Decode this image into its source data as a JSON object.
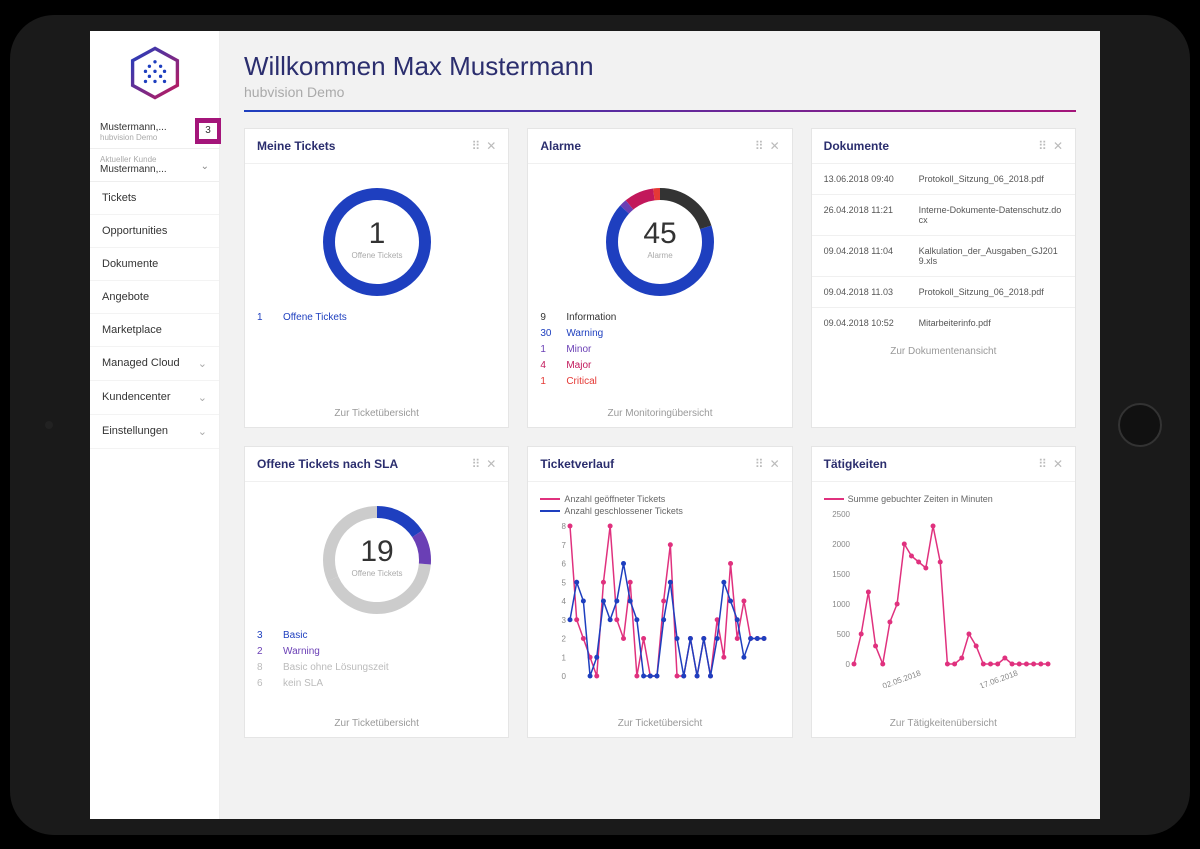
{
  "header": {
    "welcome": "Willkommen Max Mustermann",
    "subtitle": "hubvision Demo"
  },
  "sidebar": {
    "user": {
      "name": "Mustermann,...",
      "org": "hubvision Demo",
      "badge": "3"
    },
    "customer": {
      "label": "Aktueller Kunde",
      "value": "Mustermann,..."
    },
    "items": [
      {
        "label": "Tickets",
        "expandable": false
      },
      {
        "label": "Opportunities",
        "expandable": false
      },
      {
        "label": "Dokumente",
        "expandable": false
      },
      {
        "label": "Angebote",
        "expandable": false
      },
      {
        "label": "Marketplace",
        "expandable": false
      },
      {
        "label": "Managed Cloud",
        "expandable": true
      },
      {
        "label": "Kundencenter",
        "expandable": true
      },
      {
        "label": "Einstellungen",
        "expandable": true
      }
    ]
  },
  "widgets": {
    "tickets": {
      "title": "Meine Tickets",
      "value": "1",
      "caption": "Offene Tickets",
      "legend": [
        {
          "n": "1",
          "label": "Offene Tickets",
          "color": "#1e3fbf"
        }
      ],
      "footer": "Zur Ticketübersicht"
    },
    "alarms": {
      "title": "Alarme",
      "value": "45",
      "caption": "Alarme",
      "legend": [
        {
          "n": "9",
          "label": "Information",
          "color": "#333"
        },
        {
          "n": "30",
          "label": "Warning",
          "color": "#1e3fbf"
        },
        {
          "n": "1",
          "label": "Minor",
          "color": "#6a3fb5"
        },
        {
          "n": "4",
          "label": "Major",
          "color": "#c2185b"
        },
        {
          "n": "1",
          "label": "Critical",
          "color": "#e53935"
        }
      ],
      "footer": "Zur Monitoringübersicht"
    },
    "docs": {
      "title": "Dokumente",
      "rows": [
        {
          "date": "13.06.2018 09:40",
          "name": "Protokoll_Sitzung_06_2018.pdf"
        },
        {
          "date": "26.04.2018 11:21",
          "name": "Interne-Dokumente-Datenschutz.docx"
        },
        {
          "date": "09.04.2018 11:04",
          "name": "Kalkulation_der_Ausgaben_GJ2019.xls"
        },
        {
          "date": "09.04.2018 11.03",
          "name": "Protokoll_Sitzung_06_2018.pdf"
        },
        {
          "date": "09.04.2018 10:52",
          "name": "Mitarbeiterinfo.pdf"
        }
      ],
      "footer": "Zur Dokumentenansicht"
    },
    "sla": {
      "title": "Offene Tickets nach SLA",
      "value": "19",
      "caption": "Offene Tickets",
      "legend": [
        {
          "n": "3",
          "label": "Basic",
          "color": "#1e3fbf"
        },
        {
          "n": "2",
          "label": "Warning",
          "color": "#6a3fb5"
        },
        {
          "n": "8",
          "label": "Basic ohne Lösungszeit",
          "color": "#bbb"
        },
        {
          "n": "6",
          "label": "kein SLA",
          "color": "#bbb"
        }
      ],
      "footer": "Zur Ticketübersicht"
    },
    "verlauf": {
      "title": "Ticketverlauf",
      "legend_open": "Anzahl geöffneter Tickets",
      "legend_closed": "Anzahl geschlossener Tickets",
      "footer": "Zur Ticketübersicht"
    },
    "tatig": {
      "title": "Tätigkeiten",
      "legend": "Summe gebuchter Zeiten in Minuten",
      "footer": "Zur Tätigkeitenübersicht"
    }
  },
  "chart_data": [
    {
      "id": "tickets_donut",
      "type": "pie",
      "title": "Meine Tickets",
      "series": [
        {
          "name": "Offene Tickets",
          "value": 1,
          "color": "#1e3fbf"
        }
      ],
      "center_value": 1,
      "center_label": "Offene Tickets"
    },
    {
      "id": "alarms_donut",
      "type": "pie",
      "title": "Alarme",
      "series": [
        {
          "name": "Information",
          "value": 9,
          "color": "#333"
        },
        {
          "name": "Warning",
          "value": 30,
          "color": "#1e3fbf"
        },
        {
          "name": "Minor",
          "value": 1,
          "color": "#6a3fb5"
        },
        {
          "name": "Major",
          "value": 4,
          "color": "#c2185b"
        },
        {
          "name": "Critical",
          "value": 1,
          "color": "#e53935"
        }
      ],
      "center_value": 45,
      "center_label": "Alarme"
    },
    {
      "id": "sla_donut",
      "type": "pie",
      "title": "Offene Tickets nach SLA",
      "series": [
        {
          "name": "Basic",
          "value": 3,
          "color": "#1e3fbf"
        },
        {
          "name": "Warning",
          "value": 2,
          "color": "#6a3fb5"
        },
        {
          "name": "Basic ohne Lösungszeit",
          "value": 8,
          "color": "#ccc"
        },
        {
          "name": "kein SLA",
          "value": 6,
          "color": "#ccc"
        }
      ],
      "center_value": 19,
      "center_label": "Offene Tickets"
    },
    {
      "id": "ticketverlauf",
      "type": "line",
      "title": "Ticketverlauf",
      "ylabel": "",
      "ylim": [
        0,
        8
      ],
      "y_ticks": [
        0,
        1,
        2,
        3,
        4,
        5,
        6,
        7,
        8
      ],
      "series": [
        {
          "name": "Anzahl geöffneter Tickets",
          "color": "#e0317e",
          "values": [
            8,
            3,
            2,
            1,
            0,
            5,
            8,
            3,
            2,
            5,
            0,
            2,
            0,
            0,
            4,
            7,
            0,
            0,
            2,
            0,
            2,
            0,
            3,
            1,
            6,
            2,
            4,
            2,
            2,
            2
          ]
        },
        {
          "name": "Anzahl geschlossener Tickets",
          "color": "#1e3fbf",
          "values": [
            3,
            5,
            4,
            0,
            1,
            4,
            3,
            4,
            6,
            4,
            3,
            0,
            0,
            0,
            3,
            5,
            2,
            0,
            2,
            0,
            2,
            0,
            2,
            5,
            4,
            3,
            1,
            2,
            2,
            2
          ]
        }
      ]
    },
    {
      "id": "tatigkeiten",
      "type": "line",
      "title": "Tätigkeiten",
      "ylabel": "",
      "ylim": [
        0,
        2500
      ],
      "y_ticks": [
        0,
        500,
        1000,
        1500,
        2000,
        2500
      ],
      "x_tick_labels": [
        "02.05.2018",
        "17.06.2018"
      ],
      "series": [
        {
          "name": "Summe gebuchter Zeiten in Minuten",
          "color": "#e0317e",
          "values": [
            0,
            500,
            1200,
            300,
            0,
            700,
            1000,
            2000,
            1800,
            1700,
            1600,
            2300,
            1700,
            0,
            0,
            100,
            500,
            300,
            0,
            0,
            0,
            100,
            0,
            0,
            0,
            0,
            0,
            0
          ]
        }
      ]
    }
  ]
}
